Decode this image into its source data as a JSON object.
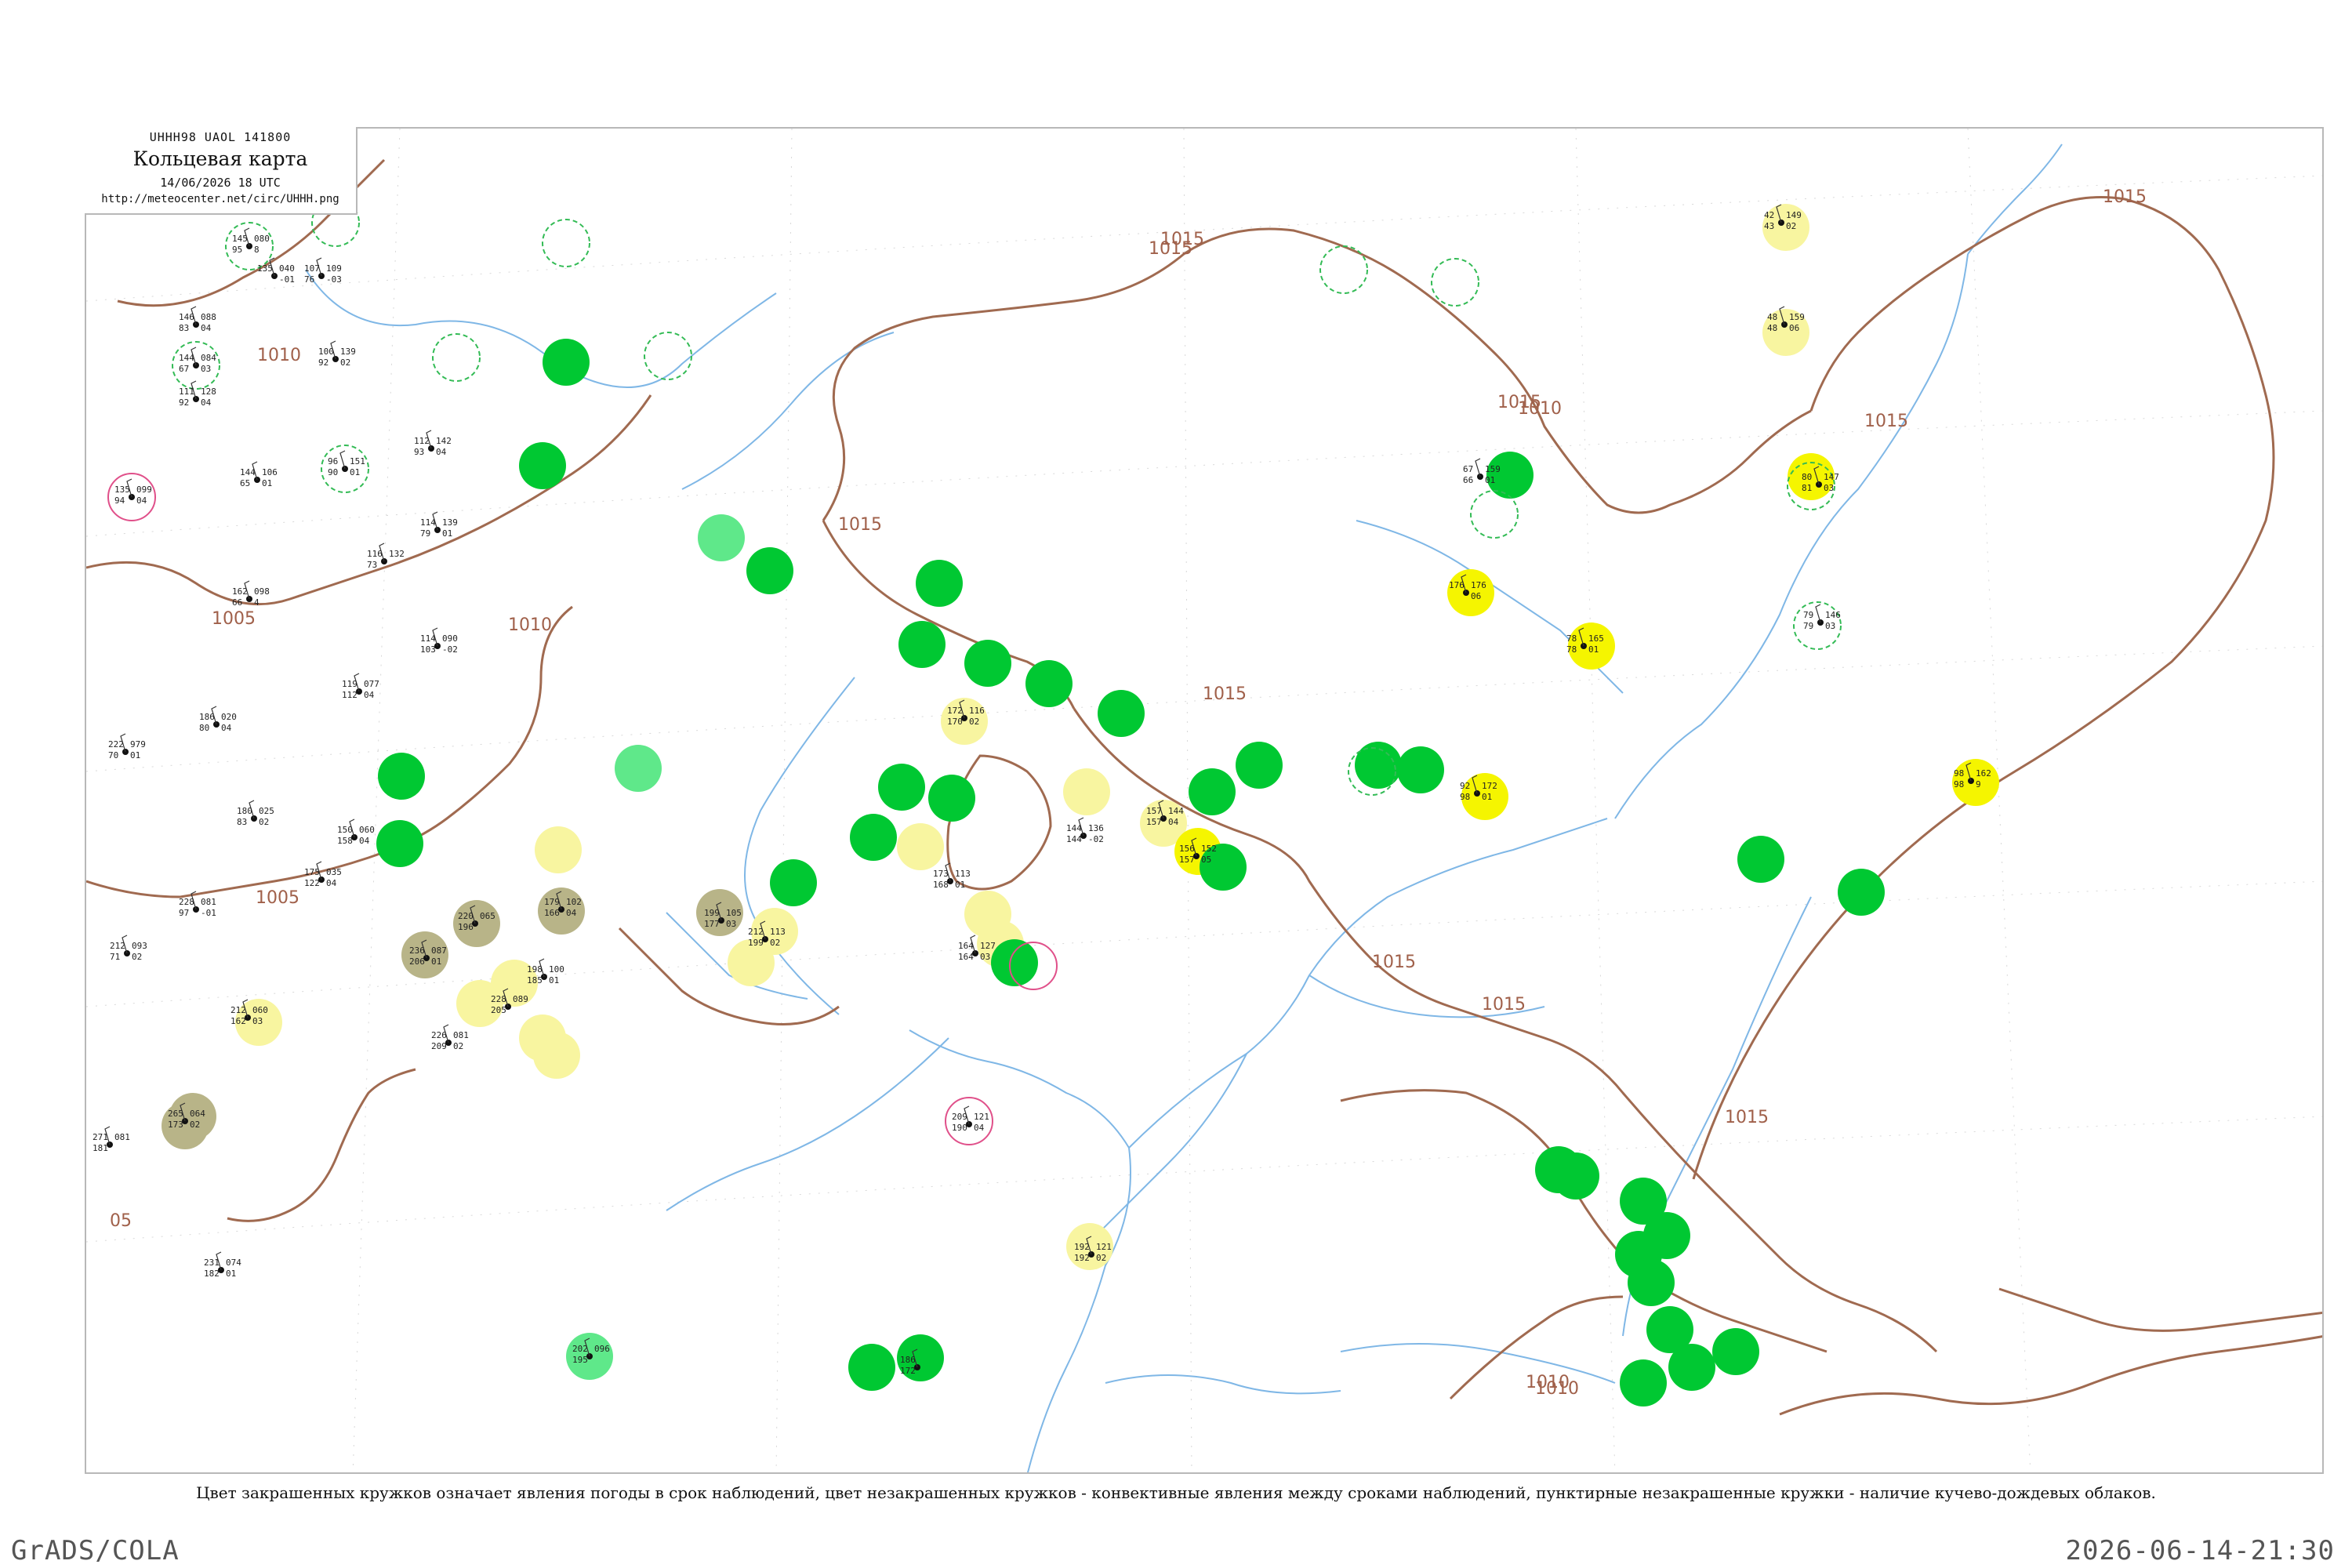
{
  "title": {
    "code": "UHHH98  UAOL  141800",
    "main": "Кольцевая карта",
    "date": "14/06/2026 18 UTC",
    "url": "http://meteocenter.net/circ/UHHH.png"
  },
  "caption": "Цвет закрашенных кружков означает явления погоды в срок наблюдений, цвет незакрашенных кружков - конвективные явления между сроками наблюдений, пунктирные незакрашенные кружки - наличие кучево-дождевых облаков.",
  "footer": {
    "left": "GrADS/COLA",
    "right": "2026-06-14-21:30"
  },
  "colors": {
    "isobar": "#a06a50",
    "river": "#7fb7e6",
    "rain_green": "#00c832",
    "shower_lightgreen": "#5fe88a",
    "fog_yellow": "#f5f500",
    "haze_paleyellow": "#f8f5a0",
    "dust_olive": "#b8b488",
    "cb_dashed_green": "#33bb55",
    "thunder_magenta": "#e0508a"
  },
  "isobar_labels": [
    "1010",
    "1015",
    "1005",
    "1010",
    "1015",
    "1015",
    "1015",
    "1015",
    "1010",
    "1015",
    "1005",
    "05",
    "1015",
    "1015",
    "1010",
    "1010",
    "1015",
    "1015"
  ],
  "stations": [
    {
      "t": "145",
      "p": "080",
      "w": "95",
      "n": "8",
      "id": "23"
    },
    {
      "t": "146",
      "p": "088",
      "w": "83",
      "n": "04",
      "id": ""
    },
    {
      "t": "144",
      "p": "084",
      "w": "67",
      "n": "03",
      "id": ""
    },
    {
      "t": "111",
      "p": "128",
      "w": "92",
      "n": "04",
      "id": ""
    },
    {
      "t": "135",
      "p": "099",
      "w": "94",
      "n": "04",
      "id": ""
    },
    {
      "t": "135",
      "p": "040",
      "w": "",
      "n": "-01",
      "id": ""
    },
    {
      "t": "107",
      "p": "109",
      "w": "76",
      "n": "-03",
      "id": ""
    },
    {
      "t": "100",
      "p": "139",
      "w": "92",
      "n": "02",
      "id": ""
    },
    {
      "t": "96",
      "p": "151",
      "w": "90",
      "n": "01",
      "id": ""
    },
    {
      "t": "112",
      "p": "142",
      "w": "93",
      "n": "04",
      "id": ""
    },
    {
      "t": "144",
      "p": "106",
      "w": "65",
      "n": "01",
      "id": ""
    },
    {
      "t": "114",
      "p": "139",
      "w": "79",
      "n": "01",
      "id": ""
    },
    {
      "t": "162",
      "p": "098",
      "w": "66",
      "n": "4",
      "id": ""
    },
    {
      "t": "116",
      "p": "132",
      "w": "73",
      "n": "",
      "id": ""
    },
    {
      "t": "114",
      "p": "090",
      "w": "103",
      "n": "-02",
      "id": ""
    },
    {
      "t": "119",
      "p": "077",
      "w": "112",
      "n": "04",
      "id": ""
    },
    {
      "t": "186",
      "p": "020",
      "w": "80",
      "n": "04",
      "id": ""
    },
    {
      "t": "222",
      "p": "979",
      "w": "70",
      "n": "01",
      "id": ""
    },
    {
      "t": "180",
      "p": "025",
      "w": "83",
      "n": "02",
      "id": ""
    },
    {
      "t": "150",
      "p": "060",
      "w": "158",
      "n": "04",
      "id": ""
    },
    {
      "t": "175",
      "p": "035",
      "w": "122",
      "n": "04",
      "id": ""
    },
    {
      "t": "228",
      "p": "081",
      "w": "97",
      "n": "-01",
      "id": ""
    },
    {
      "t": "212",
      "p": "093",
      "w": "71",
      "n": "02",
      "id": ""
    },
    {
      "t": "212",
      "p": "060",
      "w": "162",
      "n": "03",
      "id": ""
    },
    {
      "t": "231",
      "p": "074",
      "w": "182",
      "n": "01",
      "id": ""
    },
    {
      "t": "265",
      "p": "064",
      "w": "173",
      "n": "02",
      "id": ""
    },
    {
      "t": "271",
      "p": "081",
      "w": "181",
      "n": "",
      "id": ""
    },
    {
      "t": "220",
      "p": "065",
      "w": "196",
      "n": "",
      "id": ""
    },
    {
      "t": "236",
      "p": "087",
      "w": "206",
      "n": "01",
      "id": ""
    },
    {
      "t": "228",
      "p": "089",
      "w": "205",
      "n": "",
      "id": ""
    },
    {
      "t": "226",
      "p": "081",
      "w": "209",
      "n": "02",
      "id": ""
    },
    {
      "t": "179",
      "p": "102",
      "w": "166",
      "n": "04",
      "id": ""
    },
    {
      "t": "198",
      "p": "100",
      "w": "185",
      "n": "01",
      "id": ""
    },
    {
      "t": "199",
      "p": "105",
      "w": "177",
      "n": "03",
      "id": ""
    },
    {
      "t": "212",
      "p": "113",
      "w": "199",
      "n": "02",
      "id": ""
    },
    {
      "t": "172",
      "p": "116",
      "w": "170",
      "n": "02",
      "id": ""
    },
    {
      "t": "173",
      "p": "113",
      "w": "168",
      "n": "01",
      "id": ""
    },
    {
      "t": "164",
      "p": "127",
      "w": "164",
      "n": "03",
      "id": ""
    },
    {
      "t": "144",
      "p": "136",
      "w": "144",
      "n": "-02",
      "id": ""
    },
    {
      "t": "157",
      "p": "144",
      "w": "157",
      "n": "04",
      "id": ""
    },
    {
      "t": "156",
      "p": "152",
      "w": "157",
      "n": "05",
      "id": ""
    },
    {
      "t": "176",
      "p": "176",
      "w": "",
      "n": "06",
      "id": ""
    },
    {
      "t": "92",
      "p": "172",
      "w": "98",
      "n": "01",
      "id": ""
    },
    {
      "t": "78",
      "p": "165",
      "w": "78",
      "n": "01",
      "id": ""
    },
    {
      "t": "67",
      "p": "159",
      "w": "66",
      "n": "01",
      "id": ""
    },
    {
      "t": "98",
      "p": "162",
      "w": "98",
      "n": "9",
      "id": ""
    },
    {
      "t": "42",
      "p": "149",
      "w": "43",
      "n": "02",
      "id": ""
    },
    {
      "t": "48",
      "p": "159",
      "w": "48",
      "n": "06",
      "id": ""
    },
    {
      "t": "80",
      "p": "147",
      "w": "81",
      "n": "03",
      "id": ""
    },
    {
      "t": "79",
      "p": "146",
      "w": "79",
      "n": "03",
      "id": ""
    },
    {
      "t": "192",
      "p": "121",
      "w": "192",
      "n": "02",
      "id": ""
    },
    {
      "t": "209",
      "p": "121",
      "w": "190",
      "n": "04",
      "id": ""
    },
    {
      "t": "202",
      "p": "096",
      "w": "195",
      "n": "",
      "id": ""
    },
    {
      "t": "186",
      "p": "",
      "w": "172",
      "n": "",
      "id": ""
    }
  ]
}
